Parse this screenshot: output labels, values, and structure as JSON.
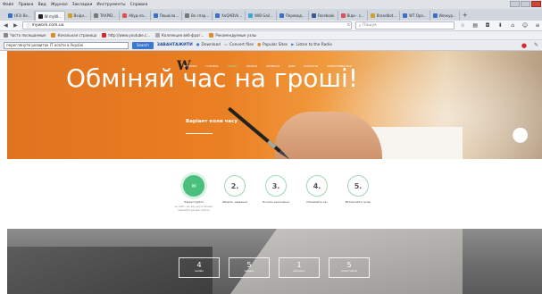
{
  "menubar": {
    "items": [
      "Файл",
      "Правка",
      "Вид",
      "Журнал",
      "Закладки",
      "Инструменты",
      "Справка"
    ]
  },
  "tabs": [
    {
      "label": "(КЗ) Вх...",
      "color": "#3b6fc4"
    },
    {
      "label": "W myW...",
      "color": "#222222",
      "active": true
    },
    {
      "label": "Вхідн...",
      "color": "#d2a026"
    },
    {
      "label": "TAXPID...",
      "color": "#777777"
    },
    {
      "label": "Абуд-ла...",
      "color": "#e05050"
    },
    {
      "label": "Пошкіла...",
      "color": "#3b6fc4"
    },
    {
      "label": "Вх спар...",
      "color": "#777777"
    },
    {
      "label": "XoQADVk...",
      "color": "#3b6fc4"
    },
    {
      "label": "WIB Gail...",
      "color": "#3fa6d9"
    },
    {
      "label": "Перевод...",
      "color": "#3b6fc4"
    },
    {
      "label": "Facebook",
      "color": "#3b5998"
    },
    {
      "label": "Віди - с...",
      "color": "#e05050"
    },
    {
      "label": "Brandbot...",
      "color": "#d2a026"
    },
    {
      "label": "WT Ора...",
      "color": "#3b6fc4"
    },
    {
      "label": "Илокур...",
      "color": "#3b6fc4"
    }
  ],
  "nav": {
    "url": "mywork.com.ua",
    "search_placeholder": "Пошук"
  },
  "bookmarks": [
    {
      "label": "Часто посещаемые",
      "color": "#888888"
    },
    {
      "label": "Начальная страница",
      "color": "#e28b2d"
    },
    {
      "label": "http://www.youtube.c...",
      "color": "#d62a2a"
    },
    {
      "label": "Коллекция веб-фраг...",
      "color": "#aaaaaa"
    },
    {
      "label": "Рекомендуемые узлы",
      "color": "#e28b2d"
    }
  ],
  "toolbar2": {
    "search_value": "переглянути розвиток IT освіти в Україні",
    "search_button": "Search",
    "brand": "ЗАВАНТАЖИТИ",
    "items": [
      "Download",
      "Convert files",
      "Popular Sites",
      "Listen to the Radio"
    ]
  },
  "site": {
    "logo": "W",
    "logo_sub": "MY WORK",
    "nav": [
      "ГОЛОВНА",
      "ПРОЕКТ",
      "ФУНКЦІЇ",
      "ПЕРЕВАГИ",
      "ЦІНИ",
      "КОНТАКТИ",
      "ЗАРЕЄСТРУВАТИСЯ"
    ],
    "hero_title": "Обміняй час на гроші!",
    "hero_sub": "Варіант коли часу",
    "features": [
      {
        "num": "1.",
        "label": "Зареєструйся",
        "desc": "на сайті, час від часу в процесі відкрийте для вас роботу"
      },
      {
        "num": "2.",
        "label": "Оберіть завдання",
        "desc": ""
      },
      {
        "num": "3.",
        "label": "Почніть виконання",
        "desc": ""
      },
      {
        "num": "4.",
        "label": "Отримайте час",
        "desc": ""
      },
      {
        "num": "5.",
        "label": "Витрачайте гроші",
        "desc": ""
      }
    ],
    "stats": [
      {
        "num": "4",
        "label": "онлайн"
      },
      {
        "num": "5",
        "label": "завдань"
      },
      {
        "num": "1",
        "label": "виконано"
      },
      {
        "num": "5",
        "label": "користувачів"
      }
    ],
    "colors": {
      "accent": "#4bbf7c",
      "hero_orange": "#e6781f"
    }
  }
}
